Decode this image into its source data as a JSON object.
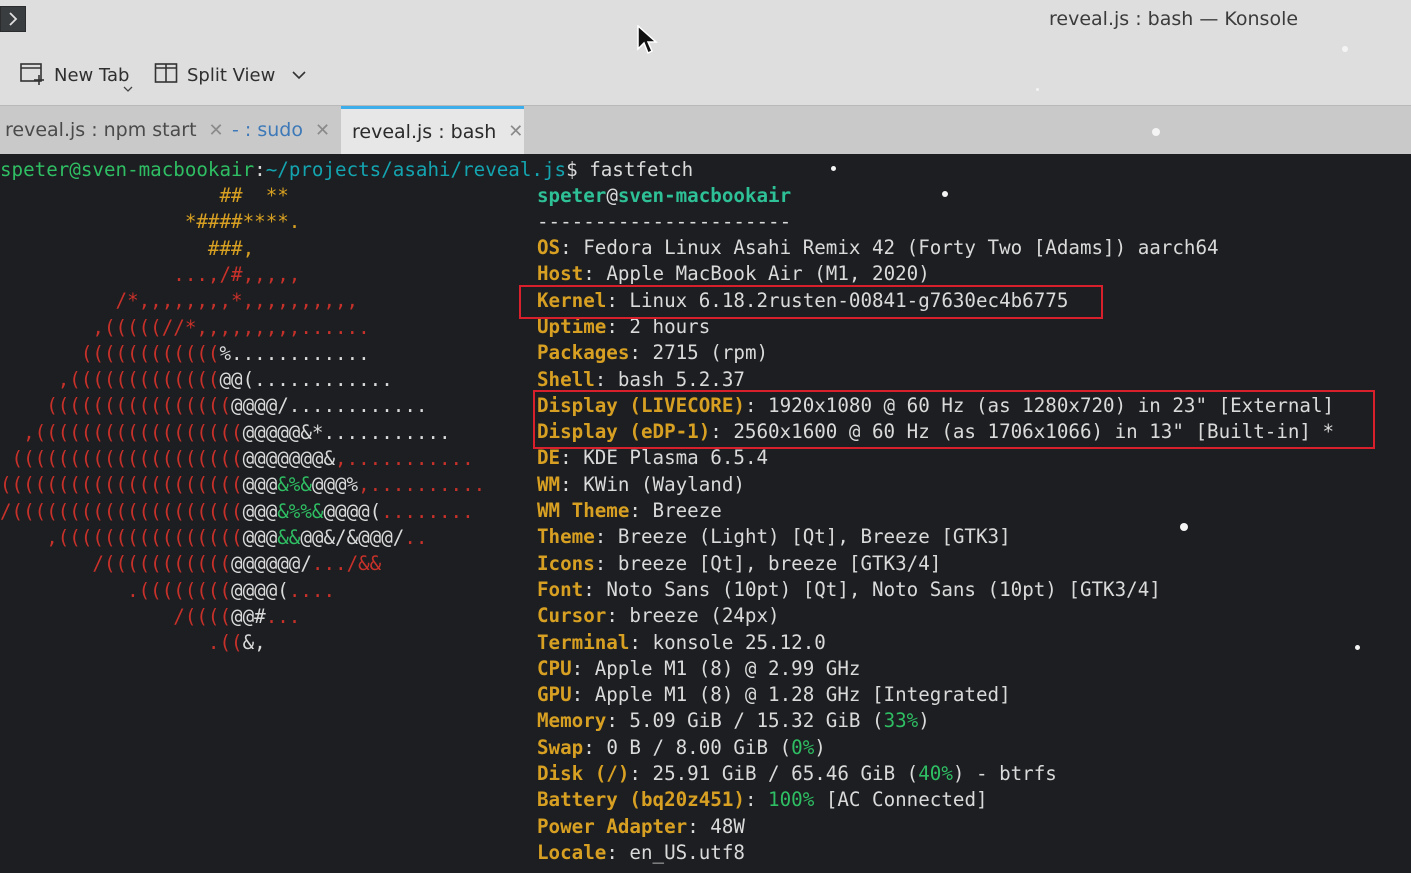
{
  "window": {
    "title": "reveal.js : bash — Konsole"
  },
  "toolbar": {
    "new_tab_label": "New Tab",
    "split_view_label": "Split View"
  },
  "tabs": [
    {
      "label": "reveal.js : npm start",
      "active": false
    },
    {
      "label": "- : sudo",
      "active": false
    },
    {
      "label": "reveal.js : bash",
      "active": true
    }
  ],
  "terminal": {
    "prompt": {
      "user_host": "speter@sven-macbookair",
      "colon": ":",
      "path": "~/projects/asahi/reveal.js",
      "symbol": "$",
      "command": "fastfetch"
    },
    "logo_lines": [
      [
        {
          "t": "                   ##  **",
          "c": "yellow"
        }
      ],
      [
        {
          "t": "                *####****.",
          "c": "yellow"
        }
      ],
      [
        {
          "t": "                  ###,",
          "c": "yellow"
        }
      ],
      [
        {
          "t": "               ...,/#,,,,,",
          "c": "red"
        }
      ],
      [
        {
          "t": "          /*,,,,,,,,*,,,,,,,,,,",
          "c": "red"
        }
      ],
      [
        {
          "t": "        ,(((((//*,,,,,,,,,......",
          "c": "red"
        }
      ],
      [
        {
          "t": "       ((((((((((((",
          "c": "red"
        },
        {
          "t": "%............",
          "c": "white"
        }
      ],
      [
        {
          "t": "     ,(((((((((((((",
          "c": "red"
        },
        {
          "t": "@@(............",
          "c": "white"
        }
      ],
      [
        {
          "t": "    ((((((((((((((((",
          "c": "red"
        },
        {
          "t": "@@@@/............",
          "c": "white"
        }
      ],
      [
        {
          "t": "  ,((((((((((((((((((",
          "c": "red"
        },
        {
          "t": "@@@@@&*...........",
          "c": "white"
        }
      ],
      [
        {
          "t": " ((((((((((((((((((((",
          "c": "red"
        },
        {
          "t": "@@@@@@@&",
          "c": "white"
        },
        {
          "t": ",...........",
          "c": "red"
        }
      ],
      [
        {
          "t": "(((((((((((((((((((((",
          "c": "red"
        },
        {
          "t": "@@@",
          "c": "white"
        },
        {
          "t": "&%&",
          "c": "green"
        },
        {
          "t": "@@@%",
          "c": "white"
        },
        {
          "t": ",..........",
          "c": "red"
        }
      ],
      [
        {
          "t": "/((((((((((((((((((((",
          "c": "red"
        },
        {
          "t": "@@@",
          "c": "white"
        },
        {
          "t": "&%%&",
          "c": "green"
        },
        {
          "t": "@@@@(",
          "c": "white"
        },
        {
          "t": "........",
          "c": "red"
        }
      ],
      [
        {
          "t": "    ,((((((((((((((((",
          "c": "red"
        },
        {
          "t": "@@@",
          "c": "white"
        },
        {
          "t": "&&",
          "c": "green"
        },
        {
          "t": "@@&/&@@@/",
          "c": "white"
        },
        {
          "t": "..",
          "c": "red"
        }
      ],
      [
        {
          "t": "        /(((((((((((",
          "c": "red"
        },
        {
          "t": "@@@@@@/",
          "c": "white"
        },
        {
          "t": ".../&&",
          "c": "red"
        }
      ],
      [
        {
          "t": "           .((((((((",
          "c": "red"
        },
        {
          "t": "@@@@(",
          "c": "white"
        },
        {
          "t": "....",
          "c": "red"
        }
      ],
      [
        {
          "t": "               /((((",
          "c": "red"
        },
        {
          "t": "@@#",
          "c": "white"
        },
        {
          "t": "...",
          "c": "red"
        }
      ],
      [
        {
          "t": "                  .((",
          "c": "red"
        },
        {
          "t": "&,",
          "c": "white"
        }
      ]
    ],
    "header_user": "speter",
    "header_at": "@",
    "header_host": "sven-macbookair",
    "separator": "----------------------",
    "info": [
      [
        {
          "t": "OS",
          "c": "key"
        },
        {
          "t": ": Fedora Linux Asahi Remix 42 (Forty Two [Adams]) aarch64"
        }
      ],
      [
        {
          "t": "Host",
          "c": "key"
        },
        {
          "t": ": Apple MacBook Air (M1, 2020)"
        }
      ],
      [
        {
          "t": "Kernel",
          "c": "key"
        },
        {
          "t": ": Linux 6.18.2rusten-00841-g7630ec4b6775"
        }
      ],
      [
        {
          "t": "Uptime",
          "c": "key"
        },
        {
          "t": ": 2 hours"
        }
      ],
      [
        {
          "t": "Packages",
          "c": "key"
        },
        {
          "t": ": 2715 (rpm)"
        }
      ],
      [
        {
          "t": "Shell",
          "c": "key"
        },
        {
          "t": ": bash 5.2.37"
        }
      ],
      [
        {
          "t": "Display (LIVECORE)",
          "c": "key"
        },
        {
          "t": ": 1920x1080 @ 60 Hz (as 1280x720) in 23\" [External]"
        }
      ],
      [
        {
          "t": "Display (eDP-1)",
          "c": "key"
        },
        {
          "t": ": 2560x1600 @ 60 Hz (as 1706x1066) in 13\" [Built-in] *"
        }
      ],
      [
        {
          "t": "DE",
          "c": "key"
        },
        {
          "t": ": KDE Plasma 6.5.4"
        }
      ],
      [
        {
          "t": "WM",
          "c": "key"
        },
        {
          "t": ": KWin (Wayland)"
        }
      ],
      [
        {
          "t": "WM Theme",
          "c": "key"
        },
        {
          "t": ": Breeze"
        }
      ],
      [
        {
          "t": "Theme",
          "c": "key"
        },
        {
          "t": ": Breeze (Light) [Qt], Breeze [GTK3]"
        }
      ],
      [
        {
          "t": "Icons",
          "c": "key"
        },
        {
          "t": ": breeze [Qt], breeze [GTK3/4]"
        }
      ],
      [
        {
          "t": "Font",
          "c": "key"
        },
        {
          "t": ": Noto Sans (10pt) [Qt], Noto Sans (10pt) [GTK3/4]"
        }
      ],
      [
        {
          "t": "Cursor",
          "c": "key"
        },
        {
          "t": ": breeze (24px)"
        }
      ],
      [
        {
          "t": "Terminal",
          "c": "key"
        },
        {
          "t": ": konsole 25.12.0"
        }
      ],
      [
        {
          "t": "CPU",
          "c": "key"
        },
        {
          "t": ": Apple M1 (8) @ 2.99 GHz"
        }
      ],
      [
        {
          "t": "GPU",
          "c": "key"
        },
        {
          "t": ": Apple M1 (8) @ 1.28 GHz [Integrated]"
        }
      ],
      [
        {
          "t": "Memory",
          "c": "key"
        },
        {
          "t": ": 5.09 GiB / 15.32 GiB ("
        },
        {
          "t": "33%",
          "c": "green"
        },
        {
          "t": ")"
        }
      ],
      [
        {
          "t": "Swap",
          "c": "key"
        },
        {
          "t": ": 0 B / 8.00 GiB ("
        },
        {
          "t": "0%",
          "c": "green"
        },
        {
          "t": ")"
        }
      ],
      [
        {
          "t": "Disk (/)",
          "c": "key"
        },
        {
          "t": ": 25.91 GiB / 65.46 GiB ("
        },
        {
          "t": "40%",
          "c": "green"
        },
        {
          "t": ") - btrfs"
        }
      ],
      [
        {
          "t": "Battery (bq20z451)",
          "c": "key"
        },
        {
          "t": ": "
        },
        {
          "t": "100%",
          "c": "green"
        },
        {
          "t": " [AC Connected]"
        }
      ],
      [
        {
          "t": "Power Adapter",
          "c": "key"
        },
        {
          "t": ": 48W"
        }
      ],
      [
        {
          "t": "Locale",
          "c": "key"
        },
        {
          "t": ": en_US.utf8"
        }
      ]
    ]
  },
  "colors": {
    "highlight_box": "#d8202c",
    "active_tab_accent": "#3daee9",
    "terminal_background": "#1c1e21"
  }
}
